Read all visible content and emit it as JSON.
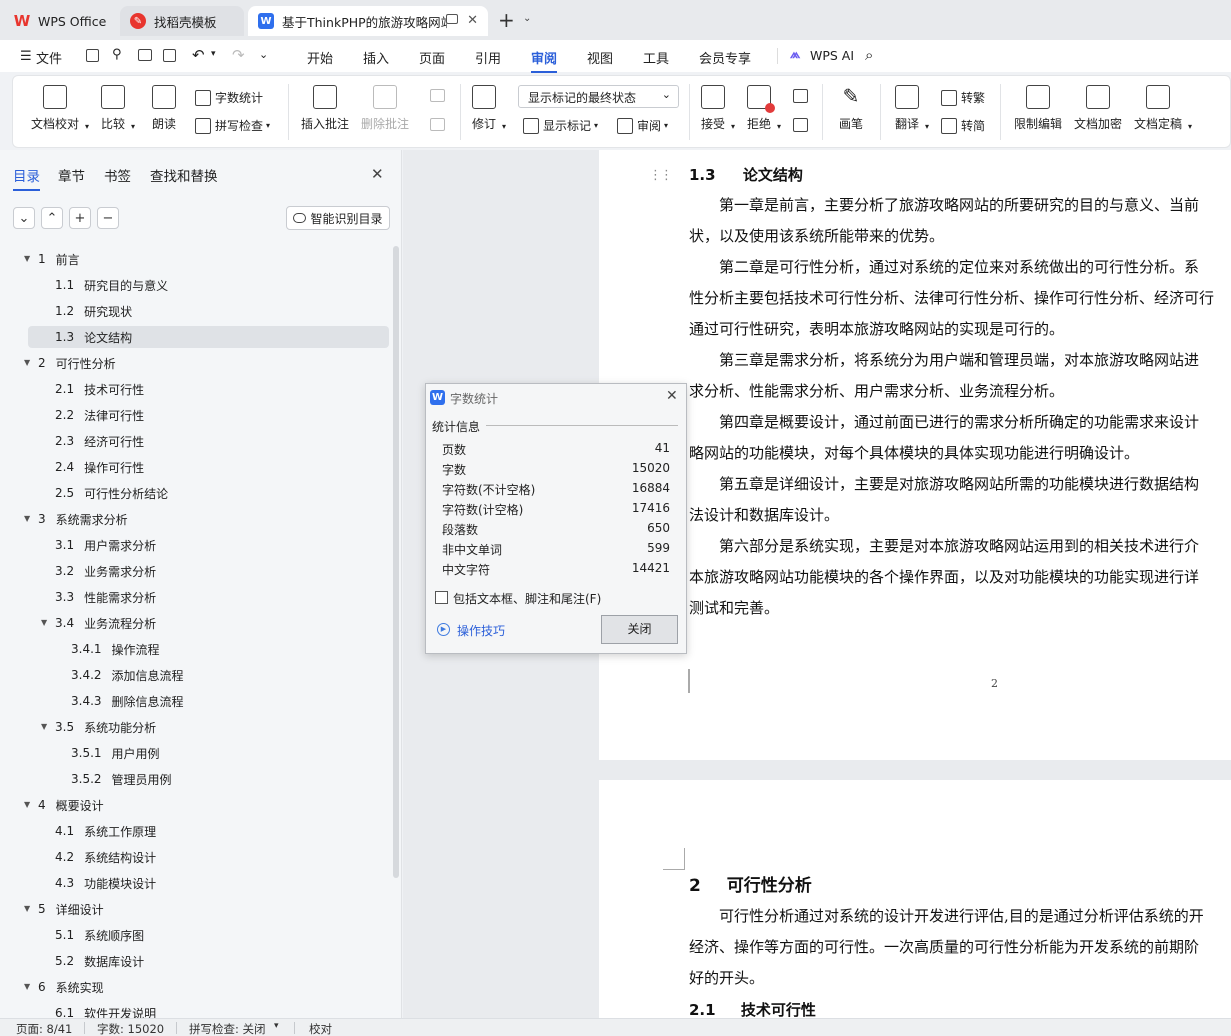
{
  "tabs": [
    {
      "label": "WPS Office"
    },
    {
      "label": "找稻壳模板"
    },
    {
      "label": "基于ThinkPHP的旅游攻略网站"
    }
  ],
  "menu": {
    "file": "文件",
    "items": [
      "开始",
      "插入",
      "页面",
      "引用",
      "审阅",
      "视图",
      "工具",
      "会员专享"
    ],
    "active": "审阅",
    "wps_ai": "WPS AI"
  },
  "ribbon": {
    "doc_check": "文档校对",
    "compare": "比较",
    "read_aloud": "朗读",
    "word_count": "字数统计",
    "spell_check": "拼写检查",
    "insert_comment": "插入批注",
    "delete_comment": "删除批注",
    "revise": "修订",
    "markup_mode": "显示标记的最终状态",
    "show_markup": "显示标记",
    "review_pane": "审阅",
    "accept": "接受",
    "reject": "拒绝",
    "pen": "画笔",
    "translate": "翻译",
    "to_trad": "转繁",
    "to_simp": "转简",
    "restrict": "限制编辑",
    "encrypt": "文档加密",
    "finalize": "文档定稿"
  },
  "panel": {
    "tabs": [
      "目录",
      "章节",
      "书签",
      "查找和替换"
    ],
    "smart_toc": "智能识别目录",
    "toc": [
      {
        "num": "1",
        "title": "前言",
        "level": 1,
        "expanded": true
      },
      {
        "num": "1.1",
        "title": "研究目的与意义",
        "level": 2
      },
      {
        "num": "1.2",
        "title": "研究现状",
        "level": 2
      },
      {
        "num": "1.3",
        "title": "论文结构",
        "level": 2,
        "selected": true
      },
      {
        "num": "2",
        "title": "可行性分析",
        "level": 1,
        "expanded": true
      },
      {
        "num": "2.1",
        "title": "技术可行性",
        "level": 2
      },
      {
        "num": "2.2",
        "title": "法律可行性",
        "level": 2
      },
      {
        "num": "2.3",
        "title": "经济可行性",
        "level": 2
      },
      {
        "num": "2.4",
        "title": "操作可行性",
        "level": 2
      },
      {
        "num": "2.5",
        "title": "可行性分析结论",
        "level": 2
      },
      {
        "num": "3",
        "title": "系统需求分析",
        "level": 1,
        "expanded": true
      },
      {
        "num": "3.1",
        "title": "用户需求分析",
        "level": 2
      },
      {
        "num": "3.2",
        "title": "业务需求分析",
        "level": 2
      },
      {
        "num": "3.3",
        "title": "性能需求分析",
        "level": 2
      },
      {
        "num": "3.4",
        "title": "业务流程分析",
        "level": 2,
        "expanded": true
      },
      {
        "num": "3.4.1",
        "title": "操作流程",
        "level": 3
      },
      {
        "num": "3.4.2",
        "title": "添加信息流程",
        "level": 3
      },
      {
        "num": "3.4.3",
        "title": "删除信息流程",
        "level": 3
      },
      {
        "num": "3.5",
        "title": "系统功能分析",
        "level": 2,
        "expanded": true
      },
      {
        "num": "3.5.1",
        "title": "用户用例",
        "level": 3
      },
      {
        "num": "3.5.2",
        "title": "管理员用例",
        "level": 3
      },
      {
        "num": "4",
        "title": "概要设计",
        "level": 1,
        "expanded": true
      },
      {
        "num": "4.1",
        "title": "系统工作原理",
        "level": 2
      },
      {
        "num": "4.2",
        "title": "系统结构设计",
        "level": 2
      },
      {
        "num": "4.3",
        "title": "功能模块设计",
        "level": 2
      },
      {
        "num": "5",
        "title": "详细设计",
        "level": 1,
        "expanded": true
      },
      {
        "num": "5.1",
        "title": "系统顺序图",
        "level": 2
      },
      {
        "num": "5.2",
        "title": "数据库设计",
        "level": 2
      },
      {
        "num": "6",
        "title": "系统实现",
        "level": 1,
        "expanded": true
      },
      {
        "num": "6.1",
        "title": "软件开发说明",
        "level": 2
      }
    ]
  },
  "document": {
    "section_heading": {
      "num": "1.3",
      "title": "论文结构"
    },
    "lines_page1": [
      "　　第一章是前言，主要分析了旅游攻略网站的所要研究的目的与意义、当前",
      "状，以及使用该系统所能带来的优势。",
      "　　第二章是可行性分析，通过对系统的定位来对系统做出的可行性分析。系",
      "性分析主要包括技术可行性分析、法律可行性分析、操作可行性分析、经济可行",
      "通过可行性研究，表明本旅游攻略网站的实现是可行的。",
      "　　第三章是需求分析，将系统分为用户端和管理员端，对本旅游攻略网站进",
      "求分析、性能需求分析、用户需求分析、业务流程分析。",
      "　　第四章是概要设计，通过前面已进行的需求分析所确定的功能需求来设计",
      "略网站的功能模块，对每个具体模块的具体实现功能进行明确设计。",
      "　　第五章是详细设计，主要是对旅游攻略网站所需的功能模块进行数据结构",
      "法设计和数据库设计。",
      "　　第六部分是系统实现，主要是对本旅游攻略网站运用到的相关技术进行介",
      "本旅游攻略网站功能模块的各个操作界面，以及对功能模块的功能实现进行详",
      "测试和完善。"
    ],
    "page_number": "2",
    "chapter_heading": {
      "num": "2",
      "title": "可行性分析"
    },
    "lines_page2": [
      "　　可行性分析通过对系统的设计开发进行评估,目的是通过分析评估系统的开",
      "经济、操作等方面的可行性。一次高质量的可行性分析能为开发系统的前期阶",
      "好的开头。"
    ],
    "sub_heading": {
      "num": "2.1",
      "title": "技术可行性"
    }
  },
  "dialog": {
    "title": "字数统计",
    "section": "统计信息",
    "rows": [
      {
        "label": "页数",
        "value": "41"
      },
      {
        "label": "字数",
        "value": "15020"
      },
      {
        "label": "字符数(不计空格)",
        "value": "16884"
      },
      {
        "label": "字符数(计空格)",
        "value": "17416"
      },
      {
        "label": "段落数",
        "value": "650"
      },
      {
        "label": "非中文单词",
        "value": "599"
      },
      {
        "label": "中文字符",
        "value": "14421"
      }
    ],
    "checkbox_label": "包括文本框、脚注和尾注(F)",
    "checkbox_checked": false,
    "tips": "操作技巧",
    "close": "关闭"
  },
  "status": {
    "page": "页面: 8/41",
    "words": "字数: 15020",
    "spell": "拼写检查: 关闭",
    "proof": "校对"
  },
  "colors": {
    "accent": "#2b5fd9",
    "wps_red": "#e8352e",
    "wps_blue": "#2f6fed"
  }
}
